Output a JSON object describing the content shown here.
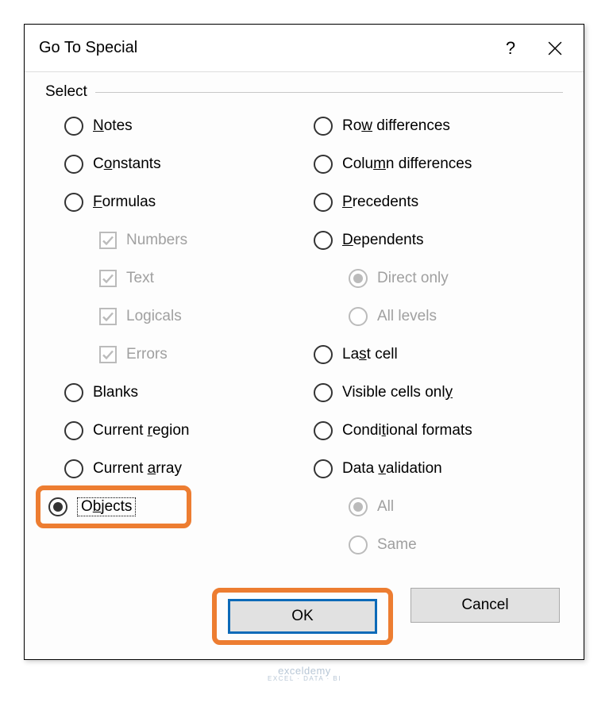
{
  "dialog": {
    "title": "Go To Special",
    "help": "?",
    "fieldset_label": "Select"
  },
  "left": {
    "notes": {
      "pre": "",
      "u": "N",
      "post": "otes"
    },
    "constants": {
      "pre": "C",
      "u": "o",
      "post": "nstants"
    },
    "formulas": {
      "pre": "",
      "u": "F",
      "post": "ormulas"
    },
    "numbers": "Numbers",
    "text": "Text",
    "logicals": "Logicals",
    "errors": "Errors",
    "blanks": "Blanks",
    "current_region": {
      "pre": "Current ",
      "u": "r",
      "post": "egion"
    },
    "current_array": {
      "pre": "Current ",
      "u": "a",
      "post": "rray"
    },
    "objects": {
      "pre": "O",
      "u": "b",
      "post": "jects"
    }
  },
  "right": {
    "rowdiff": {
      "pre": "Ro",
      "u": "w",
      "post": " differences"
    },
    "coldiff": {
      "pre": "Colu",
      "u": "m",
      "post": "n differences"
    },
    "precedents": {
      "pre": "",
      "u": "P",
      "post": "recedents"
    },
    "dependents": {
      "pre": "",
      "u": "D",
      "post": "ependents"
    },
    "direct": "Direct only",
    "alllevels": "All levels",
    "lastcell": {
      "pre": "La",
      "u": "s",
      "post": "t cell"
    },
    "visible": {
      "pre": "Visible cells onl",
      "u": "y",
      "post": ""
    },
    "condformats": {
      "pre": "Condi",
      "u": "t",
      "post": "ional formats"
    },
    "datavalidation": {
      "pre": "Data ",
      "u": "v",
      "post": "alidation"
    },
    "all": "All",
    "same": "Same"
  },
  "buttons": {
    "ok": "OK",
    "cancel": "Cancel"
  },
  "watermark": {
    "main": "exceldemy",
    "sub": "EXCEL · DATA · BI"
  }
}
